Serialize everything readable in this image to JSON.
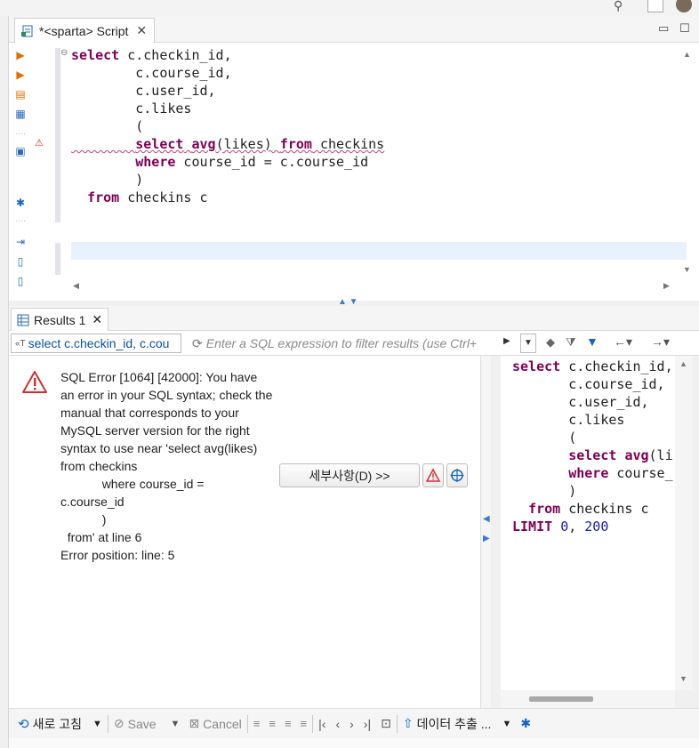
{
  "editor_tab": {
    "title": "*<sparta> Script",
    "close": "✕"
  },
  "editor": {
    "lines": [
      [
        {
          "t": "select",
          "k": "kw"
        },
        {
          "t": " c.checkin_id,"
        }
      ],
      [
        {
          "t": "        c.course_id,"
        }
      ],
      [
        {
          "t": "        c.user_id,"
        }
      ],
      [
        {
          "t": "        c.likes"
        }
      ],
      [
        {
          "t": "        ("
        }
      ],
      [
        {
          "t": "        "
        },
        {
          "t": "select",
          "k": "kw"
        },
        {
          "t": " "
        },
        {
          "t": "avg",
          "k": "kw"
        },
        {
          "t": "(likes) "
        },
        {
          "t": "from",
          "k": "kw"
        },
        {
          "t": " checkins"
        }
      ],
      [
        {
          "t": "        "
        },
        {
          "t": "where",
          "k": "kw"
        },
        {
          "t": " course_id = c.course_id"
        }
      ],
      [
        {
          "t": "        )"
        }
      ],
      [
        {
          "t": "  "
        },
        {
          "t": "from",
          "k": "kw"
        },
        {
          "t": " checkins c"
        }
      ]
    ]
  },
  "results_tab": {
    "title": "Results 1",
    "close": "✕"
  },
  "filter_bar": {
    "query_label": "select c.checkin_id, c.cou",
    "placeholder": "Enter a SQL expression to filter results (use Ctrl+"
  },
  "error": {
    "message": "SQL Error [1064] [42000]: You have an error in your SQL syntax; check the manual that corresponds to your MySQL server version for the right syntax to use near 'select avg(likes) from checkins\n            where course_id =\nc.course_id\n            )\n  from' at line 6\nError position: line: 5",
    "details_button": "세부사항(D) >>"
  },
  "sql_panel": {
    "lines": [
      [
        {
          "t": "select",
          "k": "kw"
        },
        {
          "t": " c.checkin_id,"
        }
      ],
      [
        {
          "t": "       c.course_id,"
        }
      ],
      [
        {
          "t": "       c.user_id,"
        }
      ],
      [
        {
          "t": "       c.likes"
        }
      ],
      [
        {
          "t": "       ("
        }
      ],
      [
        {
          "t": "       "
        },
        {
          "t": "select",
          "k": "kw"
        },
        {
          "t": " "
        },
        {
          "t": "avg",
          "k": "kw"
        },
        {
          "t": "(li"
        }
      ],
      [
        {
          "t": "       "
        },
        {
          "t": "where",
          "k": "kw"
        },
        {
          "t": " course_"
        }
      ],
      [
        {
          "t": "       )"
        }
      ],
      [
        {
          "t": "  "
        },
        {
          "t": "from",
          "k": "kw"
        },
        {
          "t": " checkins c"
        }
      ],
      [
        {
          "t": "LIMIT",
          "k": "kw"
        },
        {
          "t": " "
        },
        {
          "t": "0",
          "k": "num"
        },
        {
          "t": ", "
        },
        {
          "t": "200",
          "k": "num"
        }
      ]
    ]
  },
  "bottom_toolbar": {
    "refresh": "새로 고침",
    "save": "Save",
    "cancel": "Cancel",
    "export": "데이터 추출 ..."
  },
  "colors": {
    "keyword": "#7f0055",
    "number": "#1a1aa6",
    "error_red": "#d32f2f",
    "accent_blue": "#1565c0",
    "current_line": "#e8f2fe"
  }
}
